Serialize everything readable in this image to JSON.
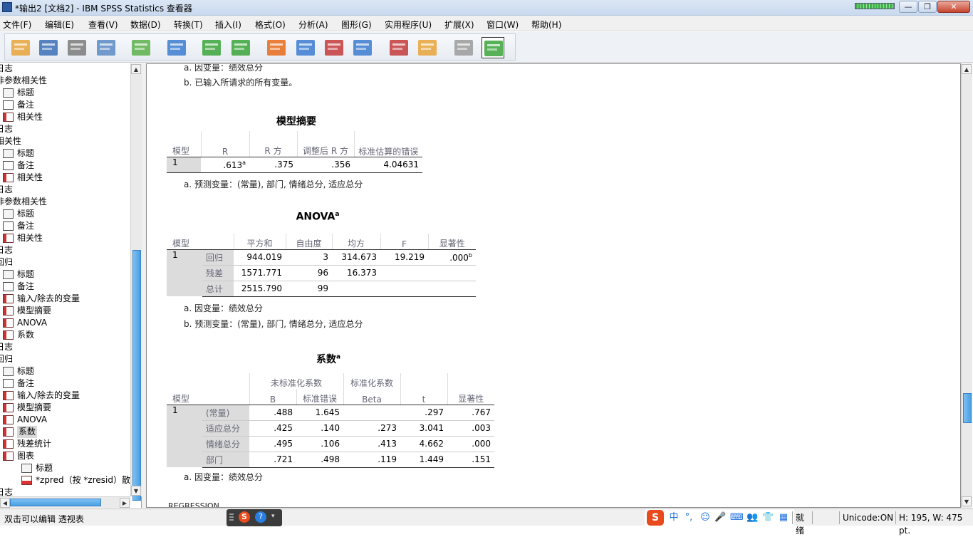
{
  "window": {
    "title": "*输出2 [文档2] - IBM SPSS Statistics 查看器",
    "minimize": "—",
    "maximize": "❐",
    "close": "✕"
  },
  "menu": [
    "文件(F)",
    "编辑(E)",
    "查看(V)",
    "数据(D)",
    "转换(T)",
    "插入(I)",
    "格式(O)",
    "分析(A)",
    "图形(G)",
    "实用程序(U)",
    "扩展(X)",
    "窗口(W)",
    "帮助(H)"
  ],
  "toolbar": [
    {
      "name": "open-icon",
      "color": "#e8a33a"
    },
    {
      "name": "save-icon",
      "color": "#3b6fb6"
    },
    {
      "name": "print-icon",
      "color": "#7a7a7a"
    },
    {
      "name": "print-preview-icon",
      "color": "#5b89c4"
    },
    {
      "name": "export-icon",
      "color": "#5ab04a"
    },
    {
      "name": "recall-dialog-icon",
      "color": "#3b7bd0"
    },
    {
      "name": "undo-icon",
      "color": "#3aa53a"
    },
    {
      "name": "redo-icon",
      "color": "#3aa53a"
    },
    {
      "name": "goto-data-icon",
      "color": "#e86a1a"
    },
    {
      "name": "goto-case-icon",
      "color": "#3b7bd0"
    },
    {
      "name": "goto-variable-icon",
      "color": "#c43a3a"
    },
    {
      "name": "variables-icon",
      "color": "#3b7bd0"
    },
    {
      "name": "designate-window-icon",
      "color": "#c43a3a"
    },
    {
      "name": "run-script-icon",
      "color": "#e8a33a"
    },
    {
      "name": "hide-icon",
      "color": "#9a9a9a"
    },
    {
      "name": "show-icon",
      "color": "#3aa53a"
    }
  ],
  "outline": [
    {
      "label": "日志",
      "indent": 0,
      "icon": "none"
    },
    {
      "label": "非参数相关性",
      "indent": 0,
      "icon": "none"
    },
    {
      "label": "标题",
      "indent": 1,
      "icon": "title"
    },
    {
      "label": "备注",
      "indent": 1,
      "icon": "note"
    },
    {
      "label": "相关性",
      "indent": 1,
      "icon": "table"
    },
    {
      "label": "日志",
      "indent": 0,
      "icon": "none"
    },
    {
      "label": "相关性",
      "indent": 0,
      "icon": "none"
    },
    {
      "label": "标题",
      "indent": 1,
      "icon": "title"
    },
    {
      "label": "备注",
      "indent": 1,
      "icon": "note"
    },
    {
      "label": "相关性",
      "indent": 1,
      "icon": "table"
    },
    {
      "label": "日志",
      "indent": 0,
      "icon": "none"
    },
    {
      "label": "非参数相关性",
      "indent": 0,
      "icon": "none"
    },
    {
      "label": "标题",
      "indent": 1,
      "icon": "title"
    },
    {
      "label": "备注",
      "indent": 1,
      "icon": "note"
    },
    {
      "label": "相关性",
      "indent": 1,
      "icon": "table"
    },
    {
      "label": "日志",
      "indent": 0,
      "icon": "none"
    },
    {
      "label": "回归",
      "indent": 0,
      "icon": "none"
    },
    {
      "label": "标题",
      "indent": 1,
      "icon": "title"
    },
    {
      "label": "备注",
      "indent": 1,
      "icon": "note"
    },
    {
      "label": "输入/除去的变量",
      "indent": 1,
      "icon": "table"
    },
    {
      "label": "模型摘要",
      "indent": 1,
      "icon": "table"
    },
    {
      "label": "ANOVA",
      "indent": 1,
      "icon": "table"
    },
    {
      "label": "系数",
      "indent": 1,
      "icon": "table"
    },
    {
      "label": "日志",
      "indent": 0,
      "icon": "none"
    },
    {
      "label": "回归",
      "indent": 0,
      "icon": "none"
    },
    {
      "label": "标题",
      "indent": 1,
      "icon": "title"
    },
    {
      "label": "备注",
      "indent": 1,
      "icon": "note"
    },
    {
      "label": "输入/除去的变量",
      "indent": 1,
      "icon": "table"
    },
    {
      "label": "模型摘要",
      "indent": 1,
      "icon": "table"
    },
    {
      "label": "ANOVA",
      "indent": 1,
      "icon": "table"
    },
    {
      "label": "系数",
      "indent": 1,
      "icon": "table",
      "selected": true
    },
    {
      "label": "残差统计",
      "indent": 1,
      "icon": "table"
    },
    {
      "label": "图表",
      "indent": 1,
      "icon": "chartgroup"
    },
    {
      "label": "标题",
      "indent": 2,
      "icon": "title"
    },
    {
      "label": "*zpred（按 *zresid）散点",
      "indent": 2,
      "icon": "chart"
    },
    {
      "label": "日志",
      "indent": 0,
      "icon": "none"
    }
  ],
  "viewer": {
    "top_note_a": "a. 因变量：绩效总分",
    "top_note_b": "b. 已输入所请求的所有变量。",
    "model_summary": {
      "title": "模型摘要",
      "headers": [
        "模型",
        "R",
        "R 方",
        "调整后 R 方",
        "标准估算的错误"
      ],
      "row": {
        "model": "1",
        "r": ".613",
        "r_sup": "a",
        "r2": ".375",
        "adj": ".356",
        "se": "4.04631"
      },
      "note": "a. 预测变量：(常量), 部门, 情绪总分, 适应总分"
    },
    "anova": {
      "title": "ANOVA",
      "title_sup": "a",
      "headers": [
        "模型",
        "",
        "平方和",
        "自由度",
        "均方",
        "F",
        "显著性"
      ],
      "model": "1",
      "rows": [
        {
          "label": "回归",
          "ss": "944.019",
          "df": "3",
          "ms": "314.673",
          "f": "19.219",
          "sig": ".000",
          "sig_sup": "b"
        },
        {
          "label": "残差",
          "ss": "1571.771",
          "df": "96",
          "ms": "16.373",
          "f": "",
          "sig": "",
          "sig_sup": ""
        },
        {
          "label": "总计",
          "ss": "2515.790",
          "df": "99",
          "ms": "",
          "f": "",
          "sig": "",
          "sig_sup": ""
        }
      ],
      "note_a": "a. 因变量：绩效总分",
      "note_b": "b. 预测变量：(常量), 部门, 情绪总分, 适应总分"
    },
    "coef": {
      "title": "系数",
      "title_sup": "a",
      "group_unstd": "未标准化系数",
      "group_std": "标准化系数",
      "headers": [
        "模型",
        "",
        "B",
        "标准错误",
        "Beta",
        "t",
        "显著性"
      ],
      "model": "1",
      "rows": [
        {
          "label": "(常量)",
          "b": ".488",
          "se": "1.645",
          "beta": "",
          "t": ".297",
          "sig": ".767"
        },
        {
          "label": "适应总分",
          "b": ".425",
          "se": ".140",
          "beta": ".273",
          "t": "3.041",
          "sig": ".003"
        },
        {
          "label": "情绪总分",
          "b": ".495",
          "se": ".106",
          "beta": ".413",
          "t": "4.662",
          "sig": ".000"
        },
        {
          "label": "部门",
          "b": ".721",
          "se": ".498",
          "beta": ".119",
          "t": "1.449",
          "sig": ".151"
        }
      ],
      "note": "a. 因变量：绩效总分"
    },
    "bottom_cut": "REGRESSION"
  },
  "status": {
    "left": "双击可以编辑 透视表",
    "ready": "就绪",
    "unicode": "Unicode:ON",
    "size": "H: 195, W: 475 pt."
  },
  "ime": {
    "logo": "S",
    "lang": "中",
    "punct": "°,",
    "items": [
      "☺",
      "🎤",
      "⌨",
      "👥",
      "👕",
      "▦"
    ]
  }
}
